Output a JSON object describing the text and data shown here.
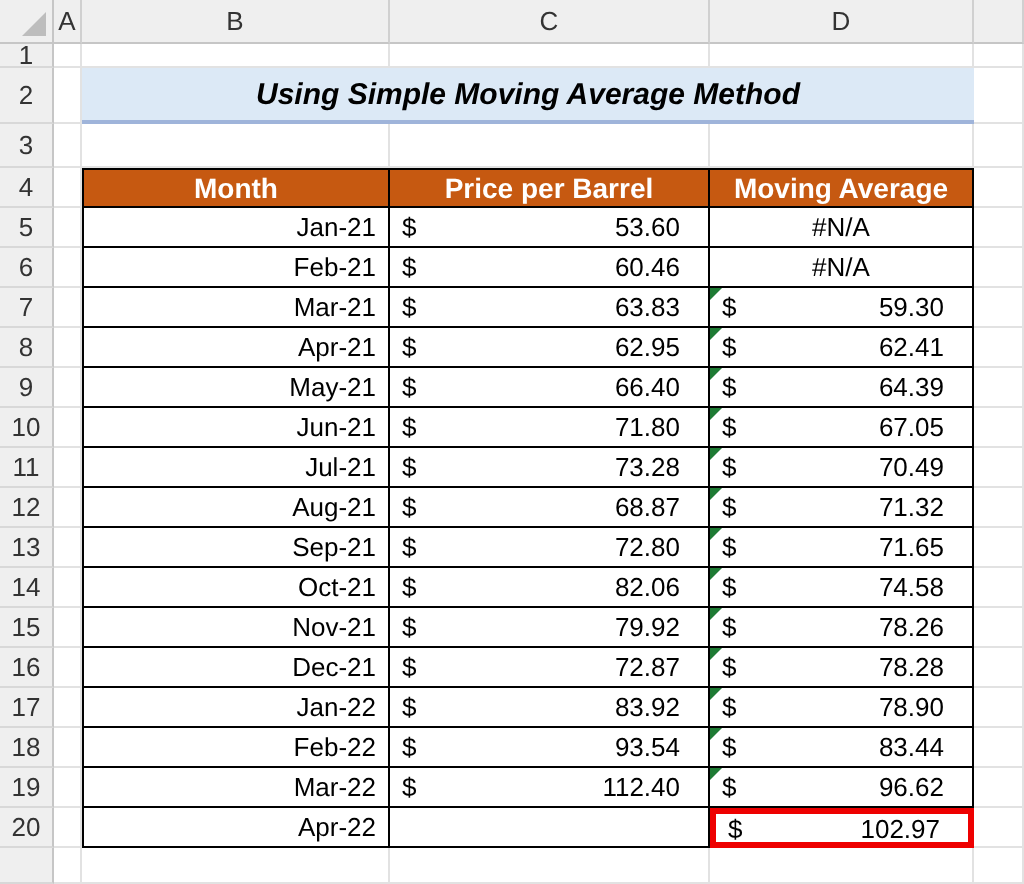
{
  "column_letters": [
    "A",
    "B",
    "C",
    "D"
  ],
  "row_numbers": [
    "1",
    "2",
    "3",
    "4",
    "5",
    "6",
    "7",
    "8",
    "9",
    "10",
    "11",
    "12",
    "13",
    "14",
    "15",
    "16",
    "17",
    "18",
    "19",
    "20"
  ],
  "title": "Using Simple Moving Average Method",
  "table": {
    "columns": [
      "Month",
      "Price per Barrel",
      "Moving Average"
    ],
    "rows": [
      {
        "month": "Jan-21",
        "price_symbol": "$",
        "price": "53.60",
        "average": "#N/A",
        "error_flag": false,
        "highlighted": false
      },
      {
        "month": "Feb-21",
        "price_symbol": "$",
        "price": "60.46",
        "average": "#N/A",
        "error_flag": false,
        "highlighted": false
      },
      {
        "month": "Mar-21",
        "price_symbol": "$",
        "price": "63.83",
        "average_symbol": "$",
        "average": "59.30",
        "error_flag": true,
        "highlighted": false
      },
      {
        "month": "Apr-21",
        "price_symbol": "$",
        "price": "62.95",
        "average_symbol": "$",
        "average": "62.41",
        "error_flag": true,
        "highlighted": false
      },
      {
        "month": "May-21",
        "price_symbol": "$",
        "price": "66.40",
        "average_symbol": "$",
        "average": "64.39",
        "error_flag": true,
        "highlighted": false
      },
      {
        "month": "Jun-21",
        "price_symbol": "$",
        "price": "71.80",
        "average_symbol": "$",
        "average": "67.05",
        "error_flag": true,
        "highlighted": false
      },
      {
        "month": "Jul-21",
        "price_symbol": "$",
        "price": "73.28",
        "average_symbol": "$",
        "average": "70.49",
        "error_flag": true,
        "highlighted": false
      },
      {
        "month": "Aug-21",
        "price_symbol": "$",
        "price": "68.87",
        "average_symbol": "$",
        "average": "71.32",
        "error_flag": true,
        "highlighted": false
      },
      {
        "month": "Sep-21",
        "price_symbol": "$",
        "price": "72.80",
        "average_symbol": "$",
        "average": "71.65",
        "error_flag": true,
        "highlighted": false
      },
      {
        "month": "Oct-21",
        "price_symbol": "$",
        "price": "82.06",
        "average_symbol": "$",
        "average": "74.58",
        "error_flag": true,
        "highlighted": false
      },
      {
        "month": "Nov-21",
        "price_symbol": "$",
        "price": "79.92",
        "average_symbol": "$",
        "average": "78.26",
        "error_flag": true,
        "highlighted": false
      },
      {
        "month": "Dec-21",
        "price_symbol": "$",
        "price": "72.87",
        "average_symbol": "$",
        "average": "78.28",
        "error_flag": true,
        "highlighted": false
      },
      {
        "month": "Jan-22",
        "price_symbol": "$",
        "price": "83.92",
        "average_symbol": "$",
        "average": "78.90",
        "error_flag": true,
        "highlighted": false
      },
      {
        "month": "Feb-22",
        "price_symbol": "$",
        "price": "93.54",
        "average_symbol": "$",
        "average": "83.44",
        "error_flag": true,
        "highlighted": false
      },
      {
        "month": "Mar-22",
        "price_symbol": "$",
        "price": "112.40",
        "average_symbol": "$",
        "average": "96.62",
        "error_flag": true,
        "highlighted": false
      },
      {
        "month": "Apr-22",
        "average_symbol": "$",
        "average": "102.97",
        "error_flag": false,
        "highlighted": true
      }
    ]
  }
}
